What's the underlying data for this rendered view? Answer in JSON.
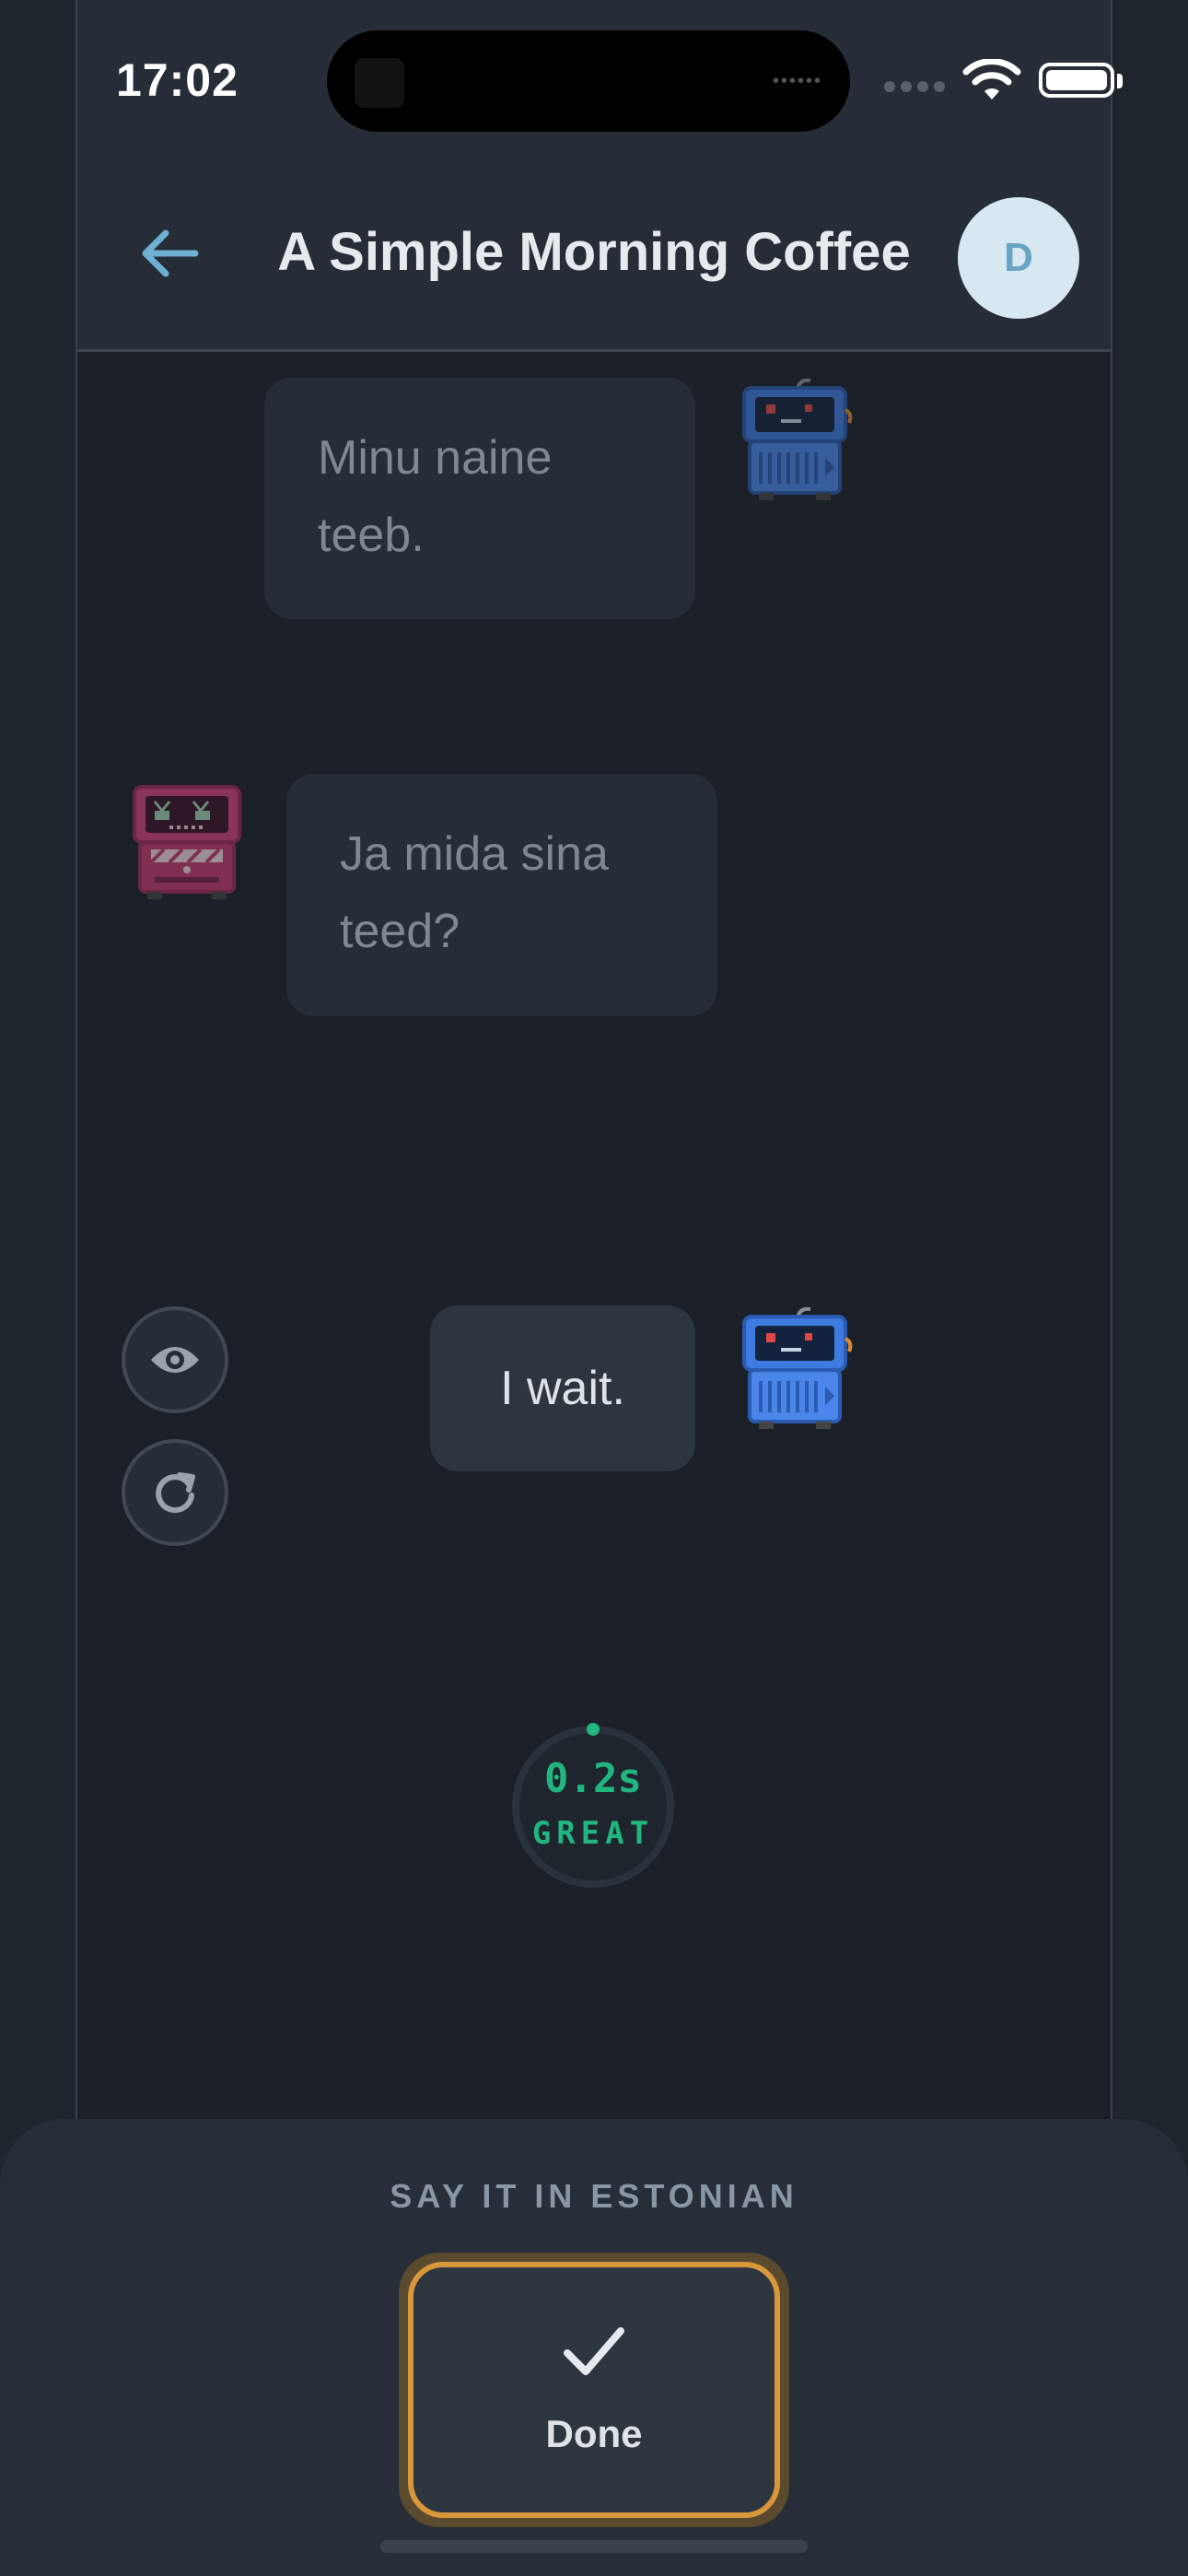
{
  "status_bar": {
    "time": "17:02"
  },
  "header": {
    "title": "A Simple Morning Coffee",
    "avatar_initial": "D"
  },
  "messages": [
    {
      "text": "Minu naine teeb.",
      "speaker": "blue-robot",
      "side": "right"
    },
    {
      "text": "Ja mida sina teed?",
      "speaker": "pink-robot",
      "side": "left"
    },
    {
      "text": "I wait.",
      "speaker": "blue-robot",
      "side": "right"
    }
  ],
  "timer": {
    "value": "0.2s",
    "label": "GREAT"
  },
  "sheet": {
    "prompt": "SAY IT IN ESTONIAN",
    "done_label": "Done"
  },
  "colors": {
    "accent_blue": "#4d8cf0",
    "accent_pink": "#c43a70",
    "timer_green": "#21b57f",
    "done_border": "#d8973a"
  }
}
